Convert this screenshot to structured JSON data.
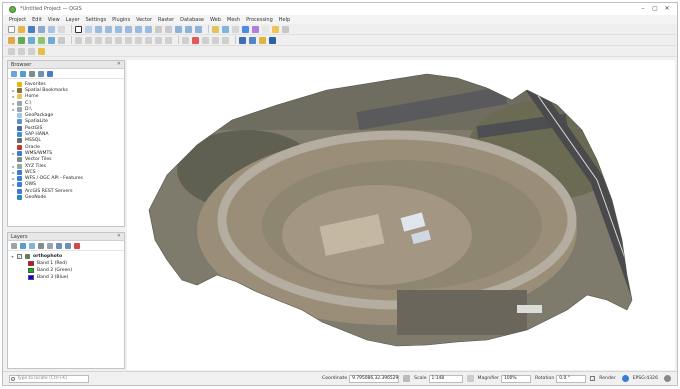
{
  "window": {
    "title": "*Untitled Project — QGIS",
    "controls": [
      "–",
      "▢",
      "✕"
    ]
  },
  "menu": [
    "Project",
    "Edit",
    "View",
    "Layer",
    "Settings",
    "Plugins",
    "Vector",
    "Raster",
    "Database",
    "Web",
    "Mesh",
    "Processing",
    "Help"
  ],
  "browser": {
    "title": "Browser",
    "items": [
      {
        "arrow": "",
        "label": "Favorites",
        "icon": "star-icon",
        "color": "#e6b800"
      },
      {
        "arrow": "▸",
        "label": "Spatial Bookmarks",
        "icon": "bookmark-icon",
        "color": "#8a6d3b"
      },
      {
        "arrow": "▸",
        "label": "Home",
        "icon": "folder-icon",
        "color": "#e8c15a"
      },
      {
        "arrow": "▸",
        "label": "C:\\",
        "icon": "drive-icon",
        "color": "#9aa4ad"
      },
      {
        "arrow": "▸",
        "label": "D:\\",
        "icon": "drive-icon",
        "color": "#9aa4ad"
      },
      {
        "arrow": "",
        "label": "GeoPackage",
        "icon": "geopackage-icon",
        "color": "#9ec7e4"
      },
      {
        "arrow": "",
        "label": "SpatiaLite",
        "icon": "spatialite-icon",
        "color": "#5b8fd0"
      },
      {
        "arrow": "",
        "label": "PostGIS",
        "icon": "postgis-icon",
        "color": "#3f6fa8"
      },
      {
        "arrow": "",
        "label": "SAP HANA",
        "icon": "database-icon",
        "color": "#3d8fd1"
      },
      {
        "arrow": "",
        "label": "MSSQL",
        "icon": "mssql-icon",
        "color": "#6b6b6b"
      },
      {
        "arrow": "",
        "label": "Oracle",
        "icon": "oracle-icon",
        "color": "#c0392b"
      },
      {
        "arrow": "▸",
        "label": "WMS/WMTS",
        "icon": "globe-icon",
        "color": "#3a7bd5"
      },
      {
        "arrow": "",
        "label": "Vector Tiles",
        "icon": "grid-icon",
        "color": "#7f8c8d"
      },
      {
        "arrow": "▸",
        "label": "XYZ Tiles",
        "icon": "tiles-icon",
        "color": "#95a5a6"
      },
      {
        "arrow": "▸",
        "label": "WCS",
        "icon": "globe-icon",
        "color": "#3a7bd5"
      },
      {
        "arrow": "▸",
        "label": "WFS / OGC API - Features",
        "icon": "globe-icon",
        "color": "#3a7bd5"
      },
      {
        "arrow": "▸",
        "label": "OWS",
        "icon": "globe-icon",
        "color": "#3a7bd5"
      },
      {
        "arrow": "",
        "label": "ArcGIS REST Servers",
        "icon": "globe-icon",
        "color": "#3a7bd5"
      },
      {
        "arrow": "",
        "label": "GeoNode",
        "icon": "geonode-icon",
        "color": "#2e86c1"
      }
    ]
  },
  "layers": {
    "title": "Layers",
    "layer_name": "orthophoto",
    "bands": [
      {
        "label": "Band 1 (Red)",
        "color": "#ff0000"
      },
      {
        "label": "Band 2 (Green)",
        "color": "#00c000"
      },
      {
        "label": "Band 3 (Blue)",
        "color": "#0000ff"
      }
    ]
  },
  "status": {
    "locator_placeholder": "Type to locate (Ctrl+K)",
    "coordinate_label": "Coordinate",
    "coordinate_value": "9.795086,32.396529",
    "scale_label": "Scale",
    "scale_value": "1:148",
    "magnifier_label": "Magnifier",
    "magnifier_value": "100%",
    "rotation_label": "Rotation",
    "rotation_value": "0.0 °",
    "render_label": "Render",
    "crs_label": "EPSG:4326"
  }
}
